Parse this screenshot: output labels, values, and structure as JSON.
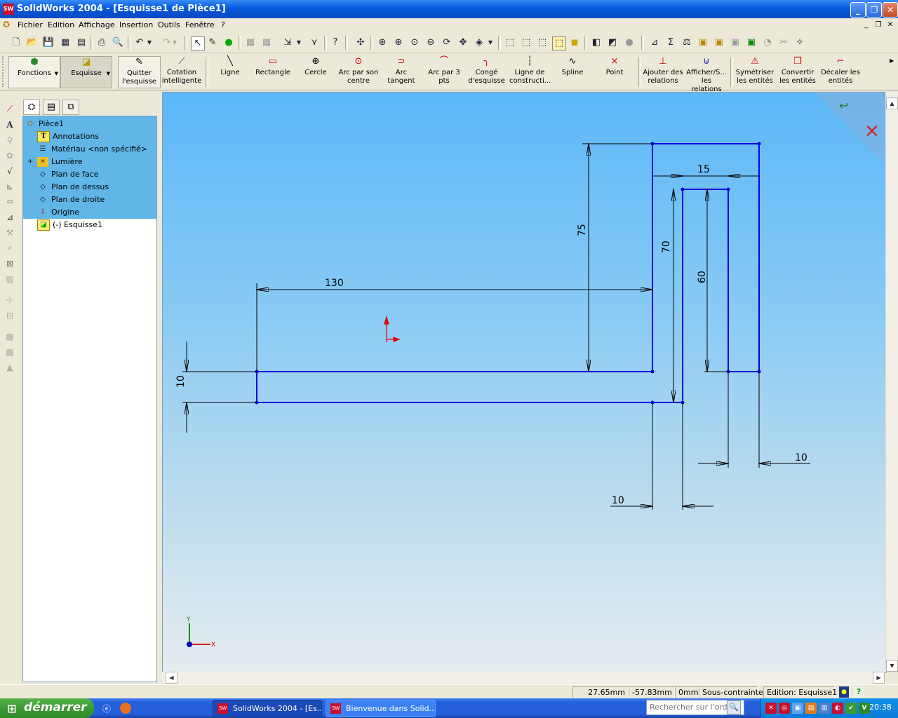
{
  "window": {
    "title": "SolidWorks 2004 - [Esquisse1 de Pièce1]",
    "app_icon": "SW"
  },
  "menu": {
    "items": [
      "Fichier",
      "Edition",
      "Affichage",
      "Insertion",
      "Outils",
      "Fenêtre",
      "?"
    ]
  },
  "command_manager": {
    "tabs": [
      {
        "label": "Fonctions"
      },
      {
        "label": "Esquisse"
      }
    ],
    "commands": [
      {
        "label": "Quitter l'esquisse"
      },
      {
        "label": "Cotation intelligente"
      },
      {
        "label": "Ligne"
      },
      {
        "label": "Rectangle"
      },
      {
        "label": "Cercle"
      },
      {
        "label": "Arc par son centre"
      },
      {
        "label": "Arc tangent"
      },
      {
        "label": "Arc par 3 pts"
      },
      {
        "label": "Congé d'esquisse"
      },
      {
        "label": "Ligne de constructi..."
      },
      {
        "label": "Spline"
      },
      {
        "label": "Point"
      },
      {
        "label": "Ajouter des relations"
      },
      {
        "label": "Afficher/S... les relations"
      },
      {
        "label": "Symétriser les entités"
      },
      {
        "label": "Convertir les entités"
      },
      {
        "label": "Décaler les entités"
      }
    ]
  },
  "feature_tree": {
    "root": "Pièce1",
    "items": [
      {
        "label": "Annotations",
        "icon": "annotations-icon"
      },
      {
        "label": "Matériau <non spécifié>",
        "icon": "material-icon"
      },
      {
        "label": "Lumière",
        "icon": "light-icon",
        "expander": "+"
      },
      {
        "label": "Plan de face",
        "icon": "plane-icon"
      },
      {
        "label": "Plan de dessus",
        "icon": "plane-icon"
      },
      {
        "label": "Plan de droite",
        "icon": "plane-icon"
      },
      {
        "label": "Origine",
        "icon": "origin-icon"
      },
      {
        "label": "(-) Esquisse1",
        "icon": "sketch-icon"
      }
    ]
  },
  "sketch": {
    "dimensions": [
      "130",
      "75",
      "70",
      "60",
      "15",
      "10",
      "10",
      "10"
    ],
    "triad": {
      "x": "X",
      "y": "Y"
    },
    "colors": {
      "geometry": "#0000e0",
      "dimension": "#000000",
      "origin": "#e00000"
    }
  },
  "status": {
    "x": "27.65mm",
    "y": "-57.83mm",
    "z": "0mm",
    "state": "Sous-contrainte",
    "edit": "Edition: Esquisse1"
  },
  "taskbar": {
    "start": "démarrer",
    "tasks": [
      "SolidWorks 2004 - [Es...",
      "Bienvenue dans Solid..."
    ],
    "search_placeholder": "Rechercher sur l'ordin",
    "clock": "20:38"
  }
}
